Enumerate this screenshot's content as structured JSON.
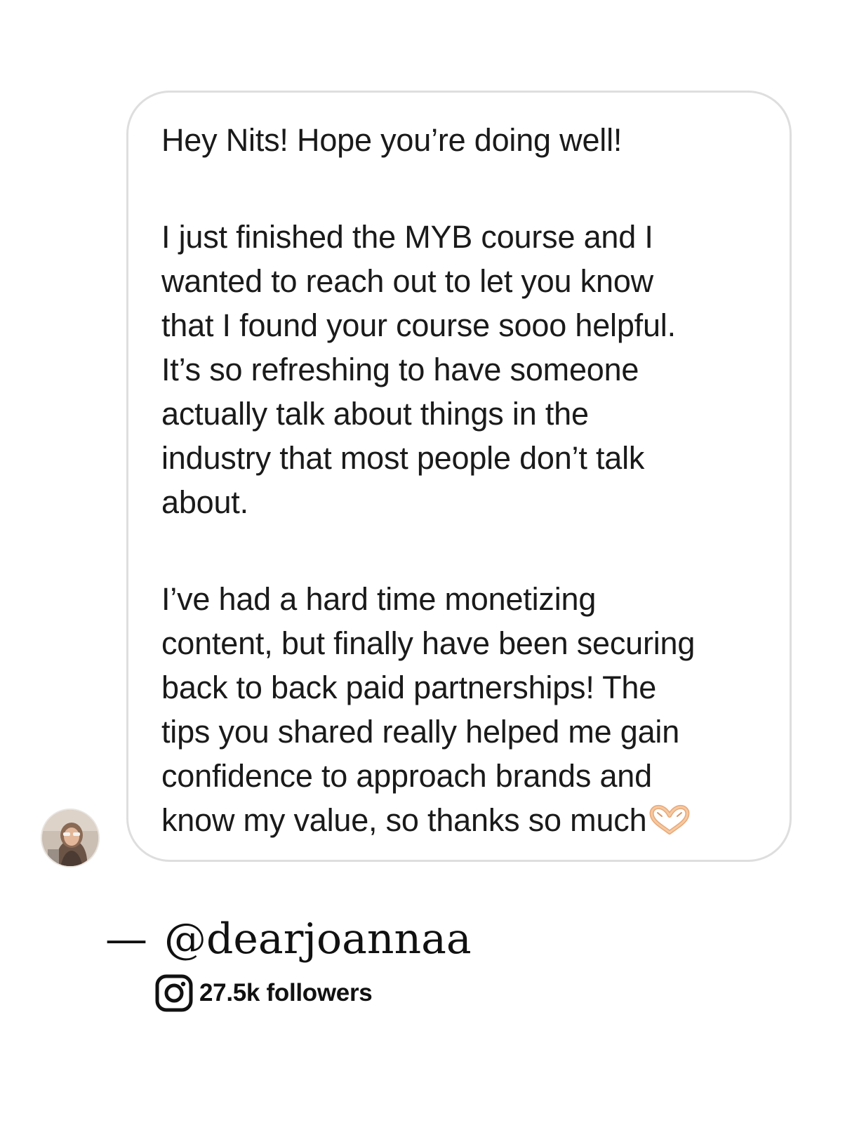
{
  "message": {
    "greeting": "Hey Nits!  Hope you’re doing well!",
    "paragraph_1": "I just finished the MYB course and I\nwanted to reach out to let you know\nthat I found your course sooo helpful.\nIt’s so refreshing to have someone\nactually talk about things in the\nindustry that most people don’t talk\nabout.",
    "paragraph_2": "I’ve had a hard time monetizing\ncontent, but finally have been securing\nback to back paid partnerships! The\ntips you shared really helped me gain\nconfidence to approach brands and\nknow my value, so thanks so much",
    "emoji": "heart-hands-emoji",
    "bubble_border_color": "#dedede"
  },
  "attribution": {
    "dash": "—",
    "handle": "@dearjoannaa",
    "platform_icon": "instagram-icon",
    "followers": "27.5k followers"
  },
  "avatar": {
    "icon": "profile-photo"
  }
}
